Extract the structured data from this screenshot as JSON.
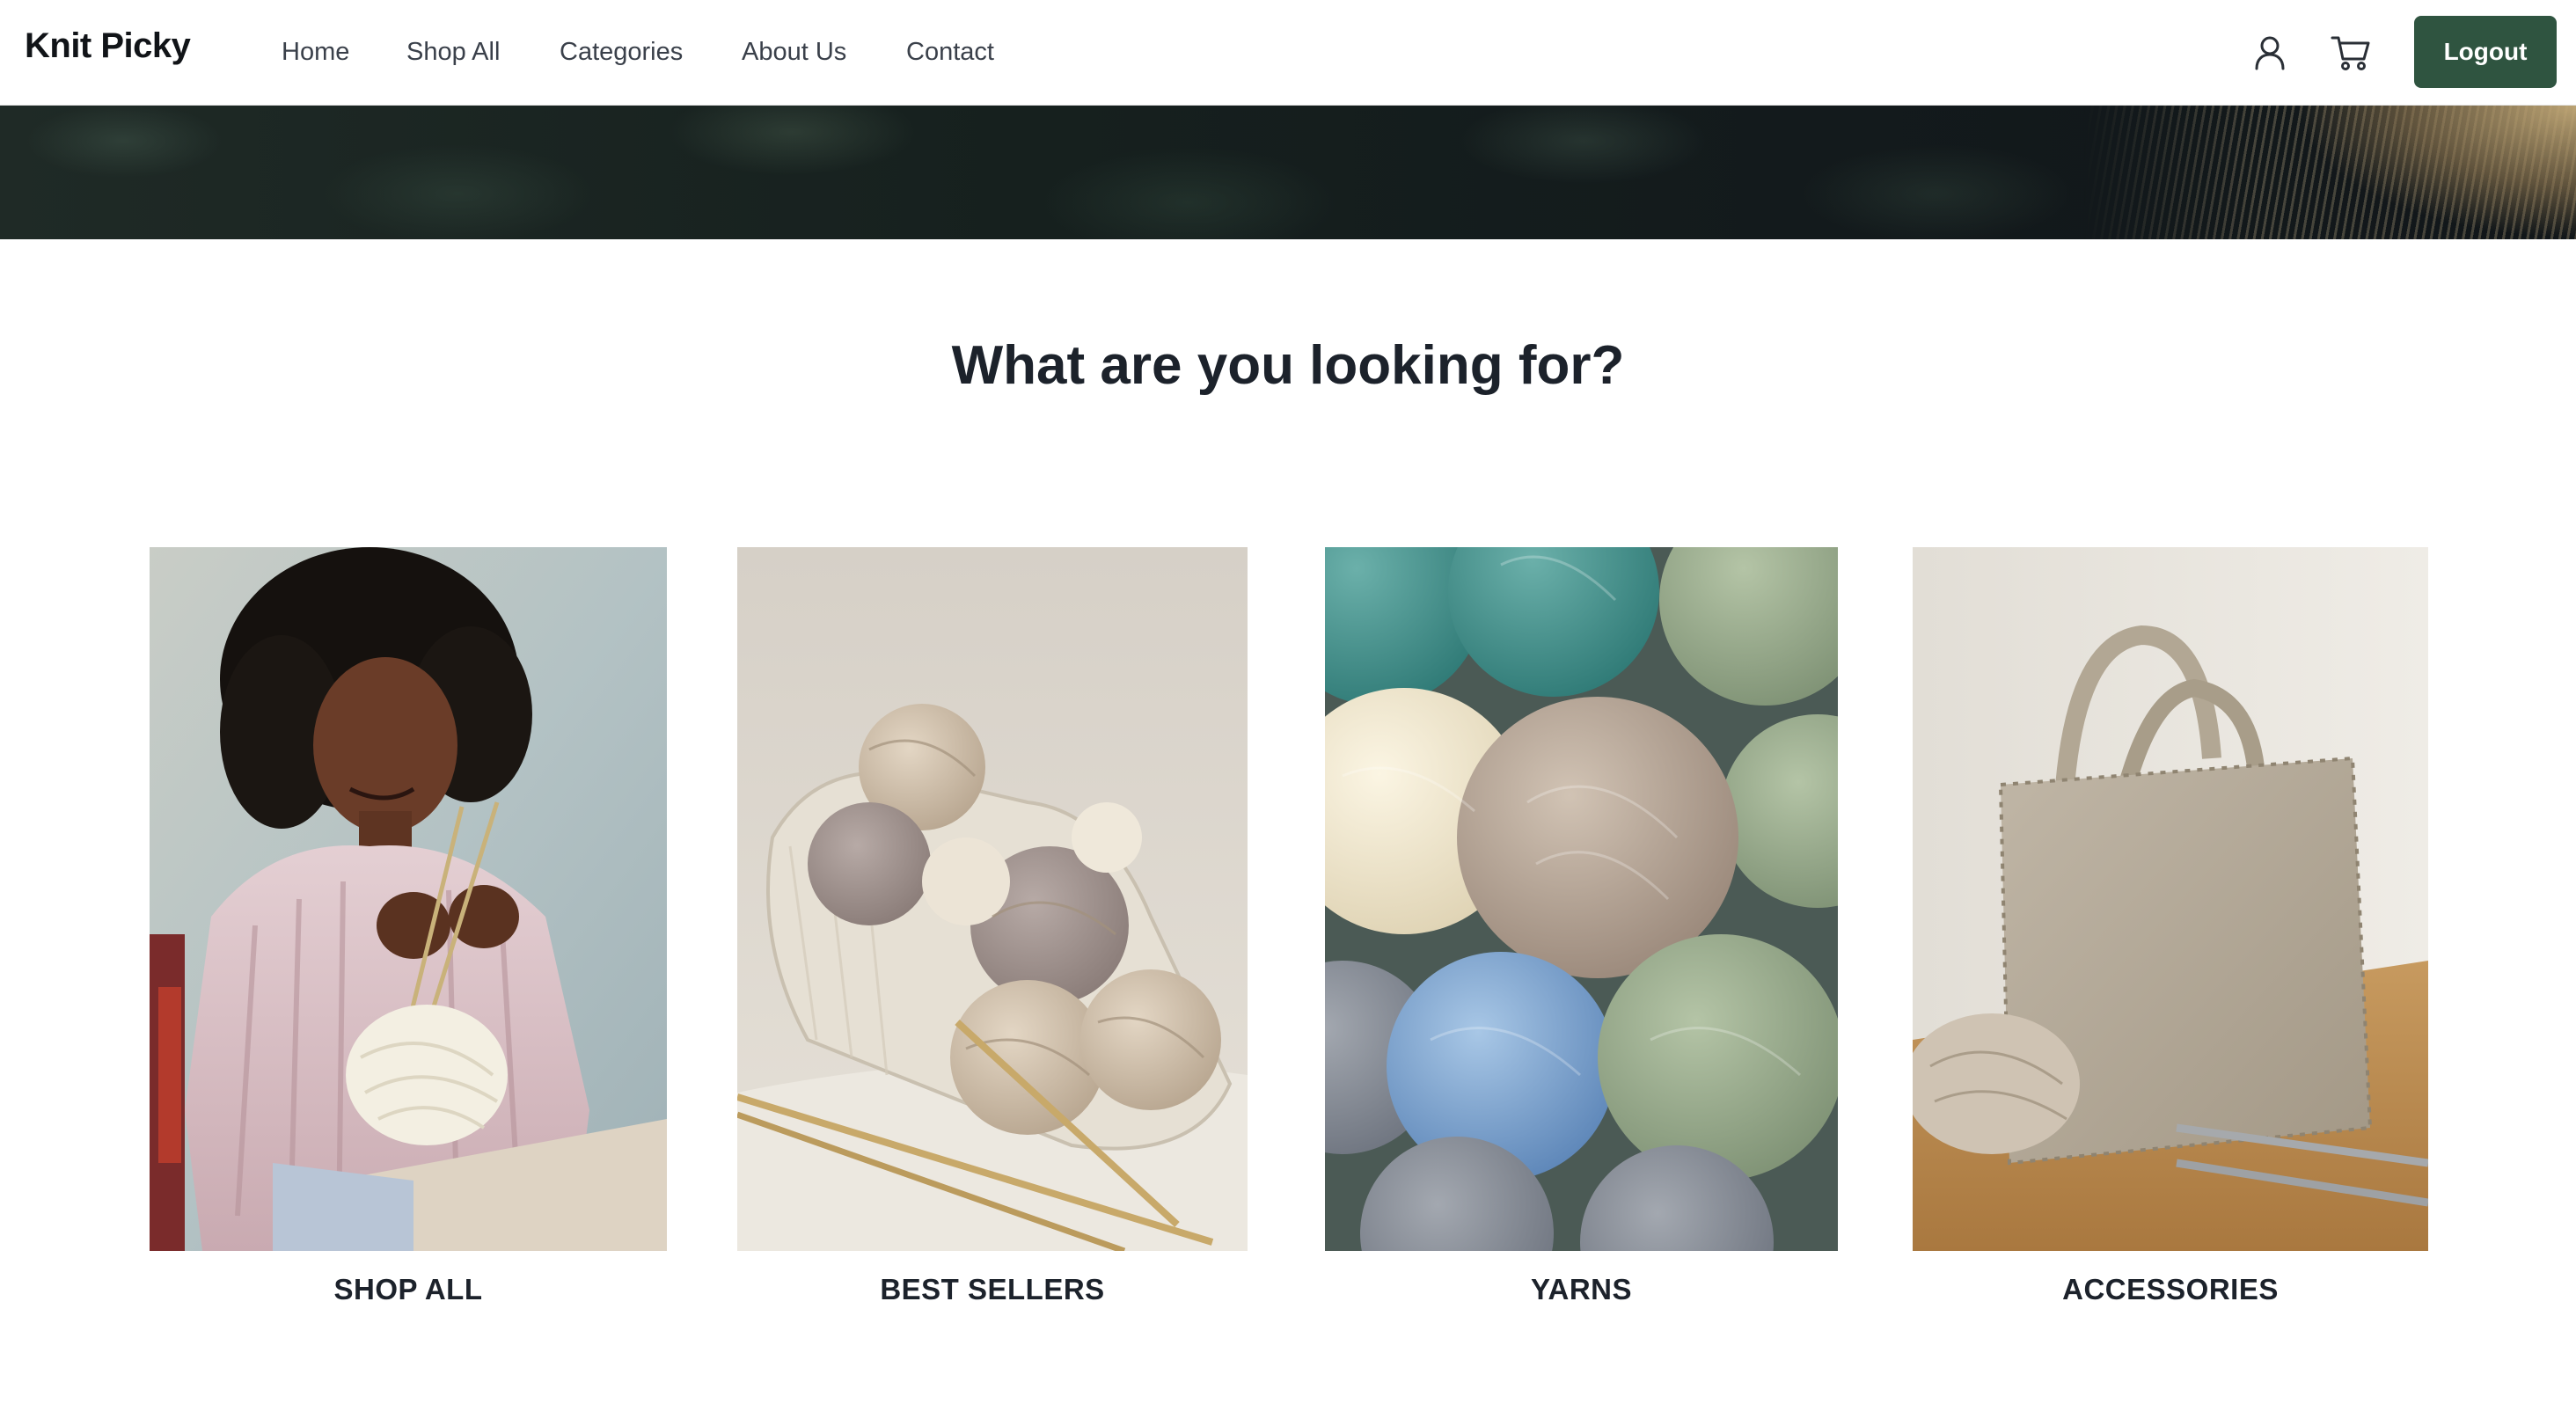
{
  "header": {
    "brand": "Knit Picky",
    "nav": [
      "Home",
      "Shop All",
      "Categories",
      "About Us",
      "Contact"
    ],
    "icons": [
      "user-icon",
      "cart-icon"
    ],
    "logout_label": "Logout"
  },
  "section": {
    "title": "What are you looking for?"
  },
  "categories": [
    {
      "label": "SHOP ALL",
      "image": "woman knitting with cream yarn"
    },
    {
      "label": "BEST SELLERS",
      "image": "knitted basket of yarn balls with needles"
    },
    {
      "label": "YARNS",
      "image": "assorted colored yarn balls"
    },
    {
      "label": "ACCESSORIES",
      "image": "linen tote bag with yarn and needles"
    }
  ],
  "colors": {
    "accent": "#2f5440",
    "text": "#1c222b",
    "nav_text": "#3a404a"
  }
}
